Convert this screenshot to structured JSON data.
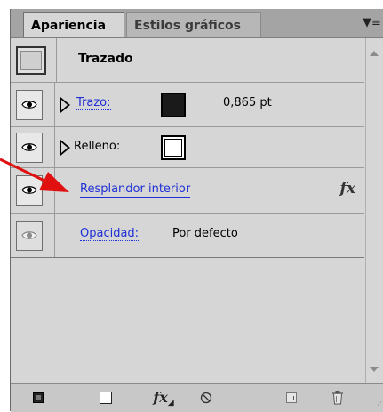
{
  "tabs": [
    {
      "label": "Apariencia",
      "active": true
    },
    {
      "label": "Estilos gráficos",
      "active": false
    }
  ],
  "header": {
    "title": "Trazado"
  },
  "rows": [
    {
      "label": "Trazo:",
      "value": "0,865 pt",
      "swatch": "#1a1a1a"
    },
    {
      "label": "Relleno:",
      "swatch": "#ffffff"
    },
    {
      "label": "Resplandor interior",
      "badge": "fx"
    },
    {
      "label": "Opacidad:",
      "value": "Por defecto"
    }
  ],
  "colors": {
    "panel_bg": "#d6d6d6",
    "link": "#1f2fd6",
    "arrow": "#e01010"
  },
  "toolbar": {
    "icons": [
      "stop-square-icon",
      "new-square-icon",
      "fx-menu-icon",
      "clear-appearance-icon",
      "duplicate-item-icon",
      "trash-icon"
    ],
    "fx_label": "fx"
  }
}
